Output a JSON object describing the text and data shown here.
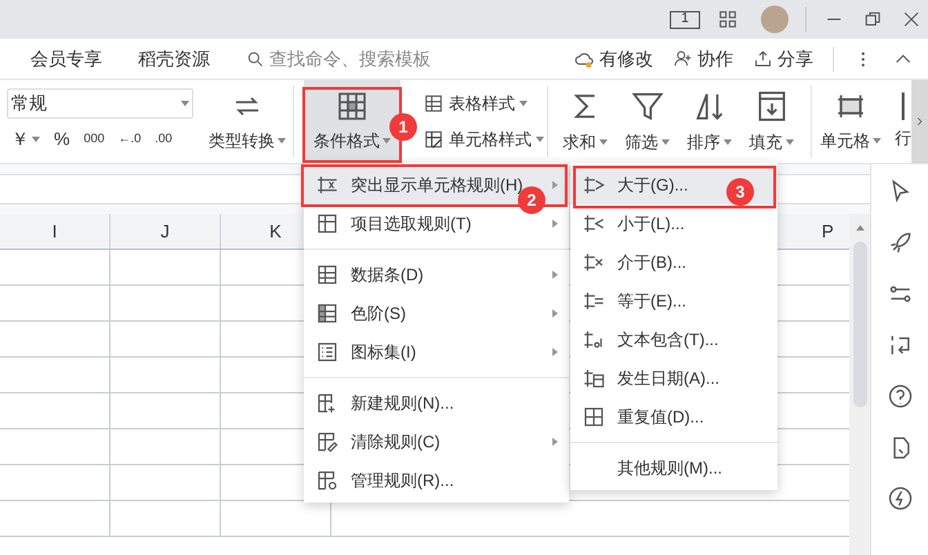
{
  "title_bar": {
    "reading_mode_label": "1"
  },
  "tabs": [
    {
      "label": "会员专享"
    },
    {
      "label": "稻壳资源"
    }
  ],
  "search": {
    "placeholder": "查找命令、搜索模板"
  },
  "actions": [
    {
      "label": "有修改"
    },
    {
      "label": "协作"
    },
    {
      "label": "分享"
    }
  ],
  "ribbon": {
    "number_format": "常规",
    "number_buttons": [
      "￥",
      "%",
      "000",
      "←.0",
      ".00"
    ],
    "convert": "类型转换",
    "conditional_format": {
      "label": "条件格式",
      "selected": true
    },
    "styles": [
      "表格样式",
      "单元格样式"
    ],
    "tools": [
      "求和",
      "筛选",
      "排序",
      "填充"
    ],
    "cells": [
      "单元格",
      "行"
    ]
  },
  "columns": [
    "I",
    "J",
    "K",
    "P"
  ],
  "menu": [
    {
      "label": "突出显示单元格规则(H)",
      "submenu": true,
      "selected": true
    },
    {
      "label": "项目选取规则(T)",
      "submenu": true,
      "selected": false
    },
    {
      "label": "数据条(D)",
      "submenu": true,
      "selected": false
    },
    {
      "label": "色阶(S)",
      "submenu": true,
      "selected": false
    },
    {
      "label": "图标集(I)",
      "submenu": true,
      "selected": false
    },
    {
      "label": "新建规则(N)...",
      "submenu": false,
      "selected": false
    },
    {
      "label": "清除规则(C)",
      "submenu": true,
      "selected": false
    },
    {
      "label": "管理规则(R)...",
      "submenu": false,
      "selected": false
    }
  ],
  "submenu": [
    {
      "label": "大于(G)...",
      "selected": true
    },
    {
      "label": "小于(L)...",
      "selected": false
    },
    {
      "label": "介于(B)...",
      "selected": false
    },
    {
      "label": "等于(E)...",
      "selected": false
    },
    {
      "label": "文本包含(T)...",
      "selected": false
    },
    {
      "label": "发生日期(A)...",
      "selected": false
    },
    {
      "label": "重复值(D)...",
      "selected": false
    },
    {
      "label": "其他规则(M)...",
      "selected": false
    }
  ],
  "annotations": [
    "1",
    "2",
    "3"
  ]
}
